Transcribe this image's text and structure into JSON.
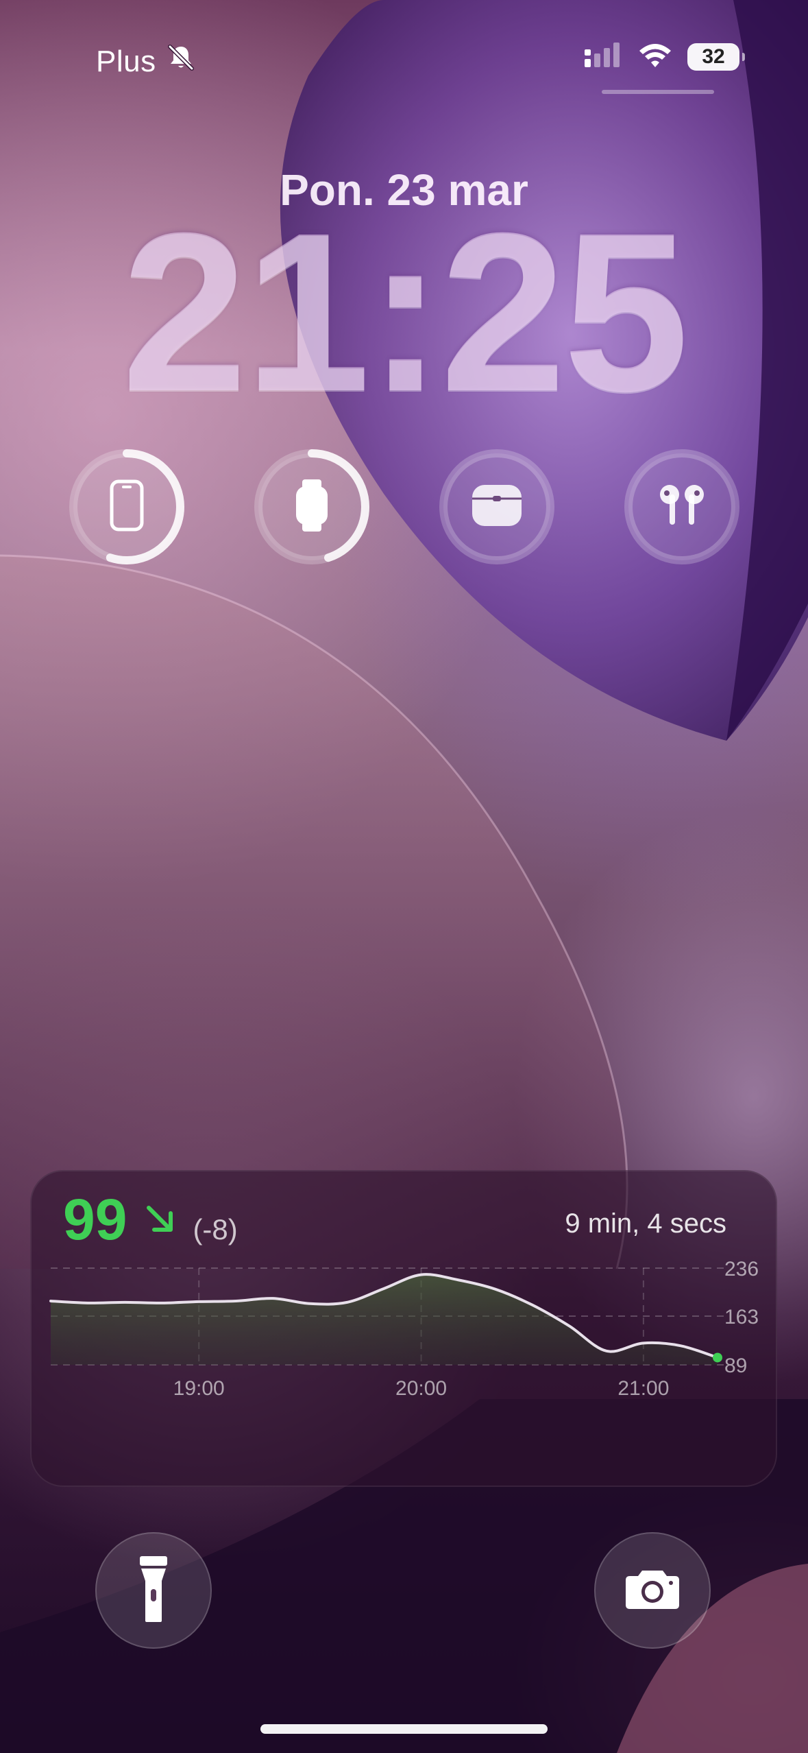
{
  "status_bar": {
    "carrier": "Plus",
    "silent_icon": "bell-slash-icon",
    "signal_icon": "cellular-signal-icon",
    "wifi_icon": "wifi-icon",
    "battery_level": "32"
  },
  "lock_screen": {
    "date": "Pon. 23 mar",
    "time": "21:25"
  },
  "battery_widgets": [
    {
      "device": "iPhone",
      "icon": "phone-icon",
      "ring_fraction": 0.55
    },
    {
      "device": "Apple Watch",
      "icon": "watch-icon",
      "ring_fraction": 0.45
    },
    {
      "device": "AirPods case",
      "icon": "airpods-case-icon",
      "ring_fraction": 0
    },
    {
      "device": "AirPods",
      "icon": "airpods-icon",
      "ring_fraction": 0
    }
  ],
  "glucose_widget": {
    "value": "99",
    "trend_icon": "arrow-down-right-icon",
    "delta": "(-8)",
    "elapsed": "9 min, 4 secs",
    "value_color": "#3fcf55"
  },
  "chart_data": {
    "type": "line",
    "y_ticks": [
      "236",
      "163",
      "89"
    ],
    "x_ticks": [
      "19:00",
      "20:00",
      "21:00"
    ],
    "ylim": [
      89,
      236
    ],
    "grid": true,
    "x": [
      "18:20",
      "18:30",
      "18:40",
      "18:50",
      "19:00",
      "19:10",
      "19:20",
      "19:30",
      "19:40",
      "19:50",
      "20:00",
      "20:10",
      "20:20",
      "20:30",
      "20:40",
      "20:50",
      "21:00",
      "21:10",
      "21:20"
    ],
    "values": [
      186,
      183,
      184,
      183,
      185,
      186,
      190,
      182,
      184,
      205,
      226,
      218,
      204,
      180,
      148,
      110,
      122,
      118,
      100
    ],
    "current_point_color": "#3fcf55"
  },
  "quick_actions": {
    "flashlight_icon": "flashlight-icon",
    "camera_icon": "camera-icon"
  }
}
